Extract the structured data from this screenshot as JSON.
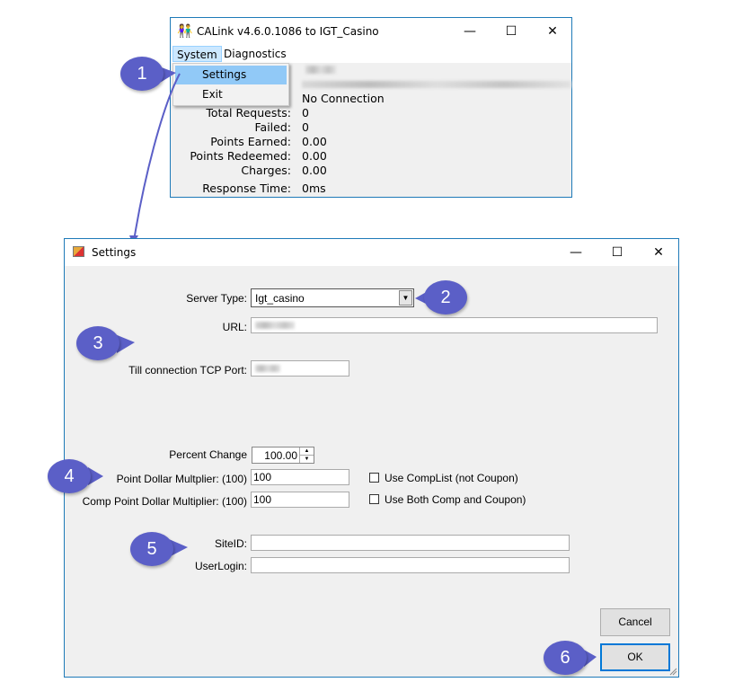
{
  "main_window": {
    "title": "CALink v4.6.0.1086 to IGT_Casino",
    "icon": "people-icon",
    "controls": {
      "minimize": "—",
      "maximize": "☐",
      "close": "✕"
    },
    "menu": [
      "System",
      "Diagnostics"
    ],
    "dropdown": [
      "Settings",
      "Exit"
    ],
    "status": "No Connection",
    "stats": [
      {
        "label": "Total Requests:",
        "value": "0"
      },
      {
        "label": "Failed:",
        "value": "0"
      },
      {
        "label": "Points Earned:",
        "value": "0.00"
      },
      {
        "label": "Points Redeemed:",
        "value": "0.00"
      },
      {
        "label": "Charges:",
        "value": "0.00"
      },
      {
        "label": "Response Time:",
        "value": "0ms"
      }
    ]
  },
  "settings_window": {
    "title": "Settings",
    "icon": "settings-window-icon",
    "controls": {
      "minimize": "—",
      "maximize": "☐",
      "close": "✕"
    },
    "server_type_label": "Server Type:",
    "server_type_value": "Igt_casino",
    "url_label": "URL:",
    "tcp_port_label": "Till connection TCP Port:",
    "percent_change_label": "Percent Change",
    "percent_change_value": "100.00",
    "point_dollar_label": "Point Dollar Multplier: (100)",
    "point_dollar_value": "100",
    "comp_point_label": "Comp Point Dollar Multiplier: (100)",
    "comp_point_value": "100",
    "use_complist_label": "Use CompList (not Coupon)",
    "use_both_label": "Use Both Comp and Coupon)",
    "siteid_label": "SiteID:",
    "userlogin_label": "UserLogin:",
    "cancel_label": "Cancel",
    "ok_label": "OK"
  },
  "callouts": [
    "1",
    "2",
    "3",
    "4",
    "5",
    "6"
  ],
  "colors": {
    "callout": "#5b5fc7",
    "window_border": "#1e7ab8",
    "highlight": "#91c9f7"
  }
}
